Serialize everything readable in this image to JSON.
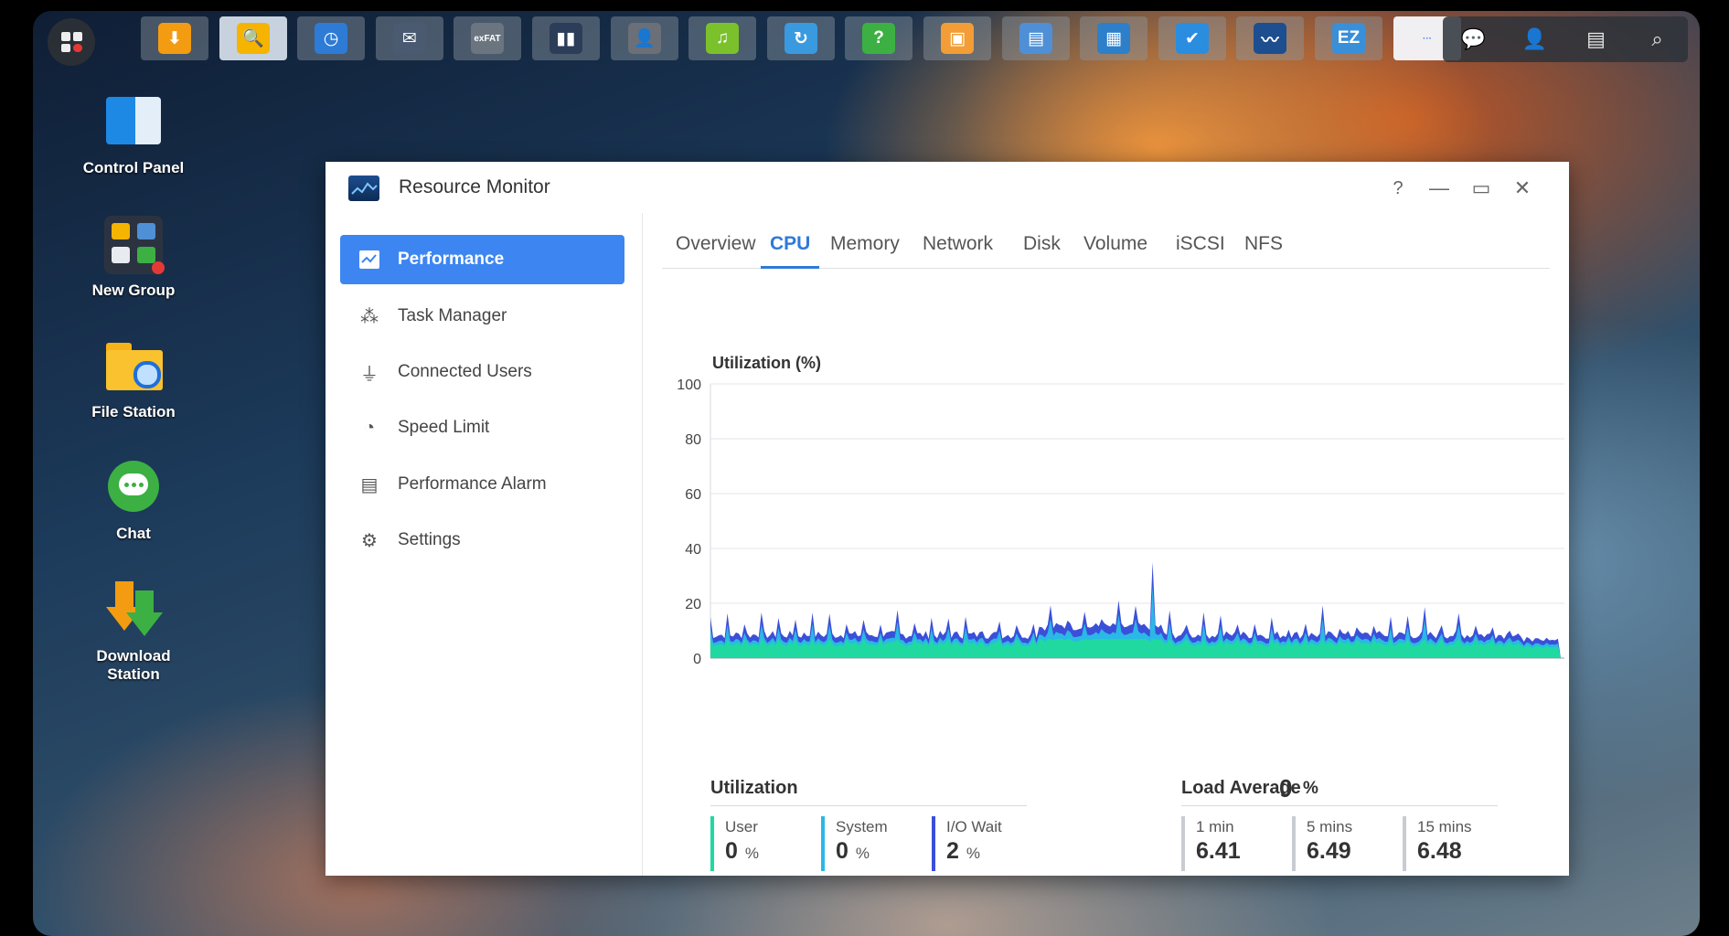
{
  "taskbar": {
    "apps": [
      {
        "name": "download-station",
        "color": "#f39c12",
        "glyph": "⬇"
      },
      {
        "name": "file-station",
        "color": "#f4b400",
        "glyph": "🔍"
      },
      {
        "name": "storage-manager",
        "color": "#2e7bd6",
        "glyph": "◷"
      },
      {
        "name": "mail-server",
        "color": "#4a5a70",
        "glyph": "✉"
      },
      {
        "name": "exfat-access",
        "color": "#6b7580",
        "glyph": "exFAT"
      },
      {
        "name": "panel-app",
        "color": "#2b3d58",
        "glyph": "▮▮"
      },
      {
        "name": "user-app",
        "color": "#6a6f78",
        "glyph": "👤"
      },
      {
        "name": "audio-station",
        "color": "#7bc12b",
        "glyph": "♫"
      },
      {
        "name": "sync-app",
        "color": "#3a9ae0",
        "glyph": "↻"
      },
      {
        "name": "help-app",
        "color": "#3cb043",
        "glyph": "?"
      },
      {
        "name": "photo-app",
        "color": "#f29d35",
        "glyph": "▣"
      },
      {
        "name": "document-app",
        "color": "#4f8fd6",
        "glyph": "▤"
      },
      {
        "name": "storage-app",
        "color": "#2d7fc9",
        "glyph": "▦"
      },
      {
        "name": "security-app",
        "color": "#2a8de0",
        "glyph": "✔"
      },
      {
        "name": "resource-monitor",
        "color": "#1d4e8f",
        "glyph": "〰"
      },
      {
        "name": "ez-app",
        "color": "#3a8fd9",
        "glyph": "EZ"
      },
      {
        "name": "more-apps",
        "color": "#ffffff",
        "glyph": "···"
      }
    ]
  },
  "tray": {
    "chat": "💬",
    "user": "👤",
    "widgets": "▤",
    "search": "⌕"
  },
  "desktop": {
    "icons": [
      {
        "label": "Control Panel"
      },
      {
        "label": "New Group"
      },
      {
        "label": "File Station"
      },
      {
        "label": "Chat"
      },
      {
        "label": "Download Station"
      }
    ]
  },
  "window": {
    "title": "Resource Monitor",
    "help": "?",
    "minimize": "—",
    "maximize": "▭",
    "close": "✕",
    "sidebar": [
      {
        "label": "Performance",
        "icon": "📈"
      },
      {
        "label": "Task Manager",
        "icon": "⁂"
      },
      {
        "label": "Connected Users",
        "icon": "⏚"
      },
      {
        "label": "Speed Limit",
        "icon": "◔"
      },
      {
        "label": "Performance Alarm",
        "icon": "▤"
      },
      {
        "label": "Settings",
        "icon": "⚙"
      }
    ],
    "tabs": [
      "Overview",
      "CPU",
      "Memory",
      "Network",
      "Disk",
      "Volume",
      "iSCSI",
      "NFS"
    ],
    "active_tab": "CPU"
  },
  "chart_data": {
    "type": "area",
    "title": "Utilization (%)",
    "ylim": [
      0,
      100
    ],
    "yticks": [
      0,
      20,
      40,
      60,
      80,
      100
    ],
    "grid": true,
    "series": [
      {
        "name": "User",
        "color": "#1fd9a0"
      },
      {
        "name": "System",
        "color": "#2ab8e6"
      },
      {
        "name": "I/O Wait",
        "color": "#3b4fd8"
      }
    ],
    "baseline_utilization": 7,
    "peak": 35
  },
  "utilization": {
    "title": "Utilization",
    "total": "0",
    "unit": "%",
    "metrics": [
      {
        "label": "User",
        "value": "0",
        "unit": "%",
        "color": "#1fd9a0"
      },
      {
        "label": "System",
        "value": "0",
        "unit": "%",
        "color": "#2ab8e6"
      },
      {
        "label": "I/O Wait",
        "value": "2",
        "unit": "%",
        "color": "#3b4fd8"
      }
    ]
  },
  "load_average": {
    "title": "Load Average",
    "items": [
      {
        "label": "1 min",
        "value": "6.41"
      },
      {
        "label": "5 mins",
        "value": "6.49"
      },
      {
        "label": "15 mins",
        "value": "6.48"
      }
    ]
  }
}
